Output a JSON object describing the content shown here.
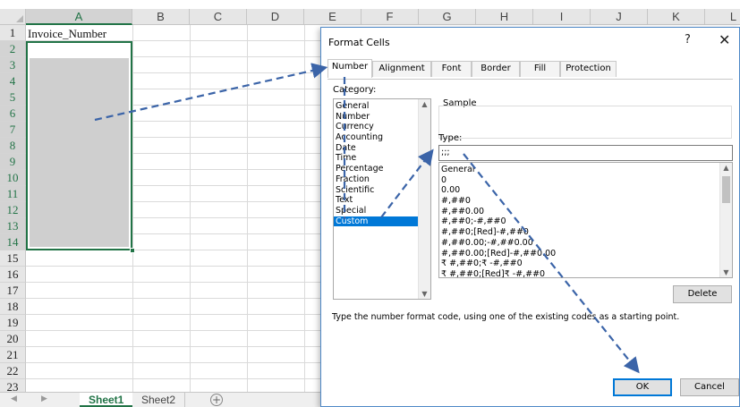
{
  "spreadsheet": {
    "columns": [
      "A",
      "B",
      "C",
      "D",
      "E",
      "F",
      "G",
      "H",
      "I",
      "J",
      "K",
      "L"
    ],
    "active_column": "A",
    "rows": [
      "1",
      "2",
      "3",
      "4",
      "5",
      "6",
      "7",
      "8",
      "9",
      "10",
      "11",
      "12",
      "13",
      "14",
      "15",
      "16",
      "17",
      "18",
      "19",
      "20",
      "21",
      "22",
      "23"
    ],
    "active_rows": [
      "2",
      "3",
      "4",
      "5",
      "6",
      "7",
      "8",
      "9",
      "10",
      "11",
      "12",
      "13",
      "14"
    ],
    "cell_a1": "Invoice_Number",
    "tabs": [
      "Sheet1",
      "Sheet2"
    ],
    "active_tab": "Sheet1",
    "add_sheet_glyph": "+",
    "accent_color": "#217346"
  },
  "dialog": {
    "title": "Format Cells",
    "help_glyph": "?",
    "close_glyph": "✕",
    "tabs": [
      "Number",
      "Alignment",
      "Font",
      "Border",
      "Fill",
      "Protection"
    ],
    "active_tab": "Number",
    "category_label": "Category:",
    "categories": [
      "General",
      "Number",
      "Currency",
      "Accounting",
      "Date",
      "Time",
      "Percentage",
      "Fraction",
      "Scientific",
      "Text",
      "Special",
      "Custom"
    ],
    "selected_category": "Custom",
    "sample_label": "Sample",
    "type_label": "Type:",
    "type_value": ";;;",
    "format_codes": [
      "General",
      "0",
      "0.00",
      "#,##0",
      "#,##0.00",
      "#,##0;-#,##0",
      "#,##0;[Red]-#,##0",
      "#,##0.00;-#,##0.00",
      "#,##0.00;[Red]-#,##0.00",
      "₹ #,##0;₹ -#,##0",
      "₹ #,##0;[Red]₹ -#,##0"
    ],
    "delete_button": "Delete",
    "description": "Type the number format code, using one of the existing codes as a starting point.",
    "ok_button": "OK",
    "cancel_button": "Cancel",
    "selection_color": "#0078d7"
  },
  "annotation": {
    "arrow_color": "#3b64a8"
  }
}
